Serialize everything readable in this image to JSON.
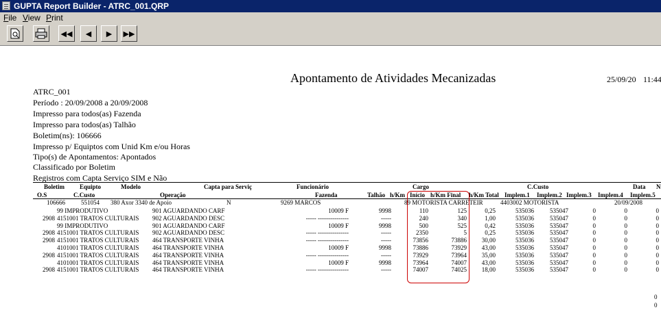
{
  "window": {
    "title": "GUPTA Report Builder - ATRC_001.QRP"
  },
  "menu": [
    "File",
    "View",
    "Print"
  ],
  "toolbar": {
    "icons": [
      "page-preview-icon",
      "printer-icon",
      "first-page-icon",
      "previous-page-icon",
      "next-page-icon",
      "last-page-icon"
    ]
  },
  "report": {
    "title": "Apontamento de Atividades Mecanizadas",
    "date": "25/09/20",
    "time": "11:44",
    "code": "ATRC_001",
    "info_lines": [
      "Período : 20/09/2008 a 20/09/2008",
      "Impresso para todos(as) Fazenda",
      "Impresso para todos(as) Talhão",
      "Boletim(ns): 106666",
      "Impresso p/ Equiptos com Unid Km e/ou Horas",
      "Tipo(s) de Apontamentos: Apontados",
      "Classificado por Boletim",
      "Registros com Capta Serviço SIM e Não"
    ],
    "headers_row1": [
      "Boletim",
      "Equipto",
      "Modelo",
      "Capta para Serviç",
      "Funcionário",
      "Cargo",
      "C.Custo",
      "Data",
      "N"
    ],
    "headers_row2": [
      "O.S",
      "C.Custo",
      "Operação",
      "Fazenda",
      "Talhão",
      "h/Km",
      "Início",
      "h/Km Final",
      "h/Km Total",
      "Implem.1",
      "Implem.2",
      "Implem.3",
      "Implem.4",
      "Implem.5"
    ],
    "boletim_row": {
      "boletim": "106666",
      "equipto": "551054",
      "modelo": "380 Axor 3340 de Apoio",
      "capta": "N",
      "funcionario": "9269 MARCOS",
      "cargo": "89 MOTORISTA CARRETEIR",
      "ccusto": "4403002 MOTORISTA",
      "data": "20/09/2008"
    },
    "rows": [
      {
        "os": "",
        "ccusto": "99 IMPRODUTIVO",
        "operacao": "901 AGUARDANDO CARF",
        "fazenda": "10009 F",
        "talhao": "9998",
        "hkm": "",
        "inicio": "110",
        "final": "125",
        "total": "0,25",
        "impl1": "535036",
        "impl2": "535047",
        "impl3": "0",
        "impl4": "0",
        "impl5": "0"
      },
      {
        "os": "2908",
        "ccusto": "4151001 TRATOS CULTURAIS",
        "operacao": "902 AGUARDANDO DESC",
        "fazenda": "----- ---------------",
        "talhao": "-----",
        "hkm": "",
        "inicio": "240",
        "final": "340",
        "total": "1,00",
        "impl1": "535036",
        "impl2": "535047",
        "impl3": "0",
        "impl4": "0",
        "impl5": "0"
      },
      {
        "os": "",
        "ccusto": "99 IMPRODUTIVO",
        "operacao": "901 AGUARDANDO CARF",
        "fazenda": "10009 F",
        "talhao": "9998",
        "hkm": "",
        "inicio": "500",
        "final": "525",
        "total": "0,42",
        "impl1": "535036",
        "impl2": "535047",
        "impl3": "0",
        "impl4": "0",
        "impl5": "0"
      },
      {
        "os": "2908",
        "ccusto": "4151001 TRATOS CULTURAIS",
        "operacao": "902 AGUARDANDO DESC",
        "fazenda": "----- ---------------",
        "talhao": "-----",
        "hkm": "",
        "inicio": "2350",
        "final": "5",
        "total": "0,25",
        "impl1": "535036",
        "impl2": "535047",
        "impl3": "0",
        "impl4": "0",
        "impl5": "0"
      },
      {
        "os": "2908",
        "ccusto": "4151001 TRATOS CULTURAIS",
        "operacao": "464 TRANSPORTE VINHA",
        "fazenda": "----- ---------------",
        "talhao": "-----",
        "hkm": "",
        "inicio": "73856",
        "final": "73886",
        "total": "30,00",
        "impl1": "535036",
        "impl2": "535047",
        "impl3": "0",
        "impl4": "0",
        "impl5": "0"
      },
      {
        "os": "",
        "ccusto": "4101001 TRATOS CULTURAIS",
        "operacao": "464 TRANSPORTE VINHA",
        "fazenda": "10009 F",
        "talhao": "9998",
        "hkm": "",
        "inicio": "73886",
        "final": "73929",
        "total": "43,00",
        "impl1": "535036",
        "impl2": "535047",
        "impl3": "0",
        "impl4": "0",
        "impl5": "0"
      },
      {
        "os": "2908",
        "ccusto": "4151001 TRATOS CULTURAIS",
        "operacao": "464 TRANSPORTE VINHA",
        "fazenda": "----- ---------------",
        "talhao": "-----",
        "hkm": "",
        "inicio": "73929",
        "final": "73964",
        "total": "35,00",
        "impl1": "535036",
        "impl2": "535047",
        "impl3": "0",
        "impl4": "0",
        "impl5": "0"
      },
      {
        "os": "",
        "ccusto": "4101001 TRATOS CULTURAIS",
        "operacao": "464 TRANSPORTE VINHA",
        "fazenda": "10009 F",
        "talhao": "9998",
        "hkm": "",
        "inicio": "73964",
        "final": "74007",
        "total": "43,00",
        "impl1": "535036",
        "impl2": "535047",
        "impl3": "0",
        "impl4": "0",
        "impl5": "0"
      },
      {
        "os": "2908",
        "ccusto": "4151001 TRATOS CULTURAIS",
        "operacao": "464 TRANSPORTE VINHA",
        "fazenda": "----- ---------------",
        "talhao": "-----",
        "hkm": "",
        "inicio": "74007",
        "final": "74025",
        "total": "18,00",
        "impl1": "535036",
        "impl2": "535047",
        "impl3": "0",
        "impl4": "0",
        "impl5": "0"
      }
    ],
    "footer_values": [
      "0",
      "0",
      "0"
    ]
  },
  "colors": {
    "titlebar": "#0a246a",
    "chrome": "#d4d0c8",
    "highlight": "#cc0000"
  }
}
